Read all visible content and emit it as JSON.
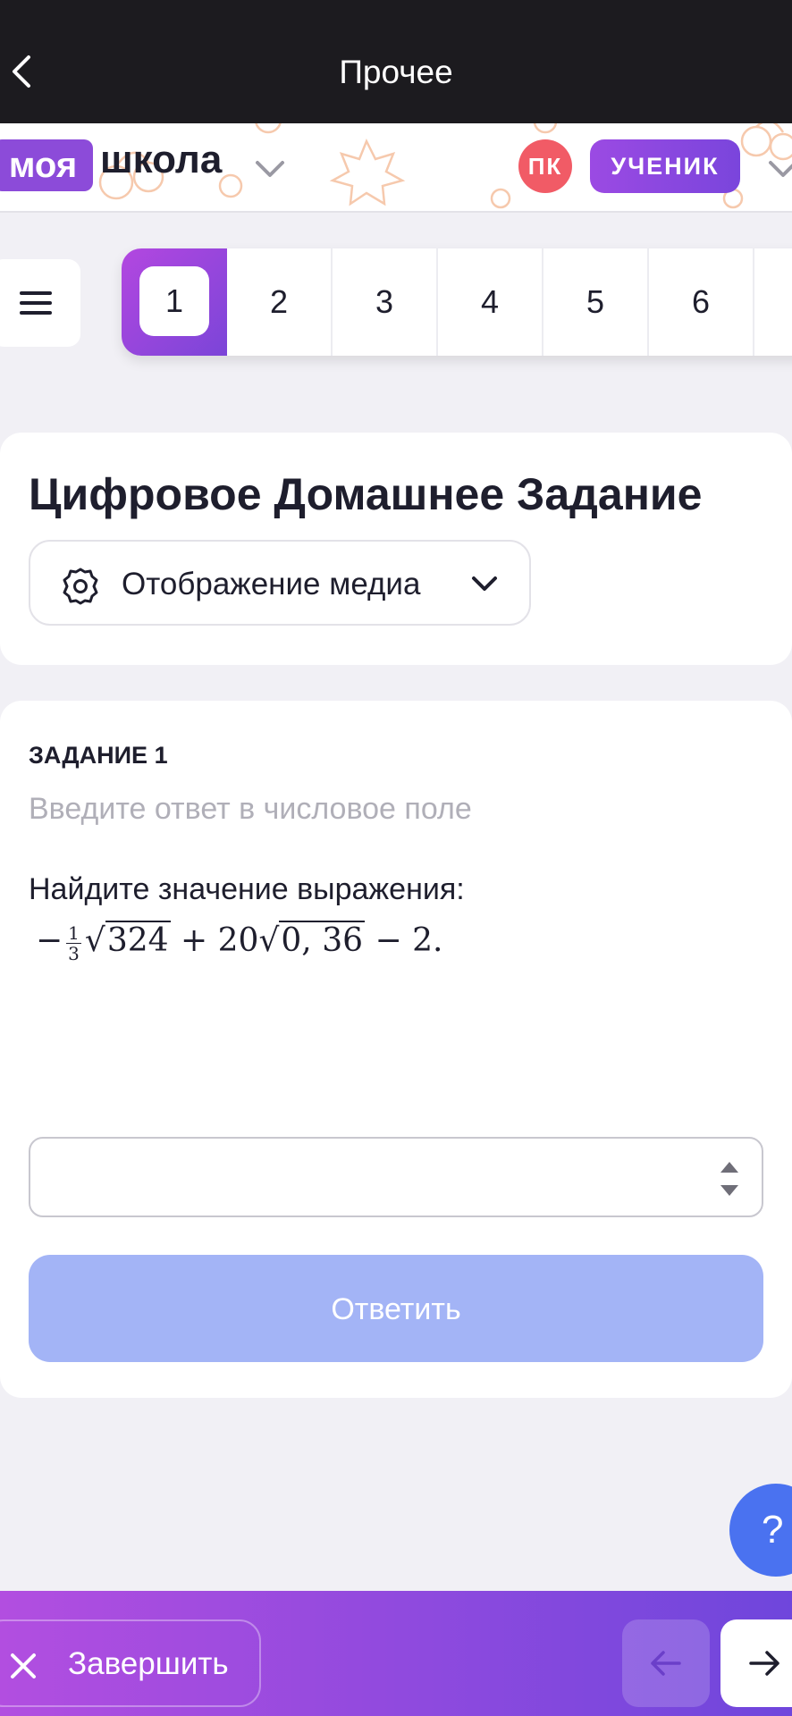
{
  "topbar": {
    "title": "Прочее",
    "back_icon": "chevron-left-icon"
  },
  "brand": {
    "logo_pill": "моя",
    "logo_text": "школа",
    "avatar_initials": "ПК",
    "role": "УЧЕНИК"
  },
  "task_nav": {
    "items": [
      "1",
      "2",
      "3",
      "4",
      "5",
      "6"
    ],
    "active": "1"
  },
  "header_card": {
    "title": "Цифровое Домашнее Задание",
    "media_button": "Отображение медиа"
  },
  "task": {
    "label": "ЗАДАНИЕ 1",
    "hint": "Введите ответ в числовое поле",
    "question": "Найдите значение выражения:",
    "formula": {
      "minus": "−",
      "frac_num": "1",
      "frac_den": "3",
      "radicand1": "324",
      "middle": "+ 20",
      "radicand2": "0, 36",
      "tail": "− 2."
    },
    "answer_value": "",
    "submit_label": "Ответить"
  },
  "help": {
    "label": "?"
  },
  "bottom": {
    "finish_label": "Завершить",
    "prev_icon": "arrow-left-icon",
    "next_icon": "arrow-right-icon"
  },
  "colors": {
    "accent_purple": "#8c4bd9",
    "submit_disabled": "#a3b4f6",
    "help_blue": "#4a72f0",
    "avatar_red": "#f15b66"
  }
}
